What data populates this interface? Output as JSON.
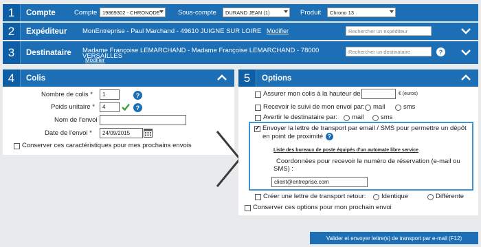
{
  "compte": {
    "number": "1",
    "title": "Compte",
    "compte_label": "Compte",
    "compte_value": "19869302 - CHRONODE",
    "sous_compte_label": "Sous-compte",
    "sous_compte_value": "DURAND JEAN (1)",
    "produit_label": "Produit",
    "produit_value": "Chrono 13",
    "chevron": "chevron-down-icon"
  },
  "expediteur": {
    "number": "2",
    "title": "Expéditeur",
    "info": "MonEntreprise - Paul Marchand - 49610 JUIGNE SUR LOIRE",
    "modifier": "Modifier",
    "search_placeholder": "Rechercher un expéditeur",
    "chevron": "chevron-down-icon"
  },
  "destinataire": {
    "number": "3",
    "title": "Destinataire",
    "info_line1": "Madame Françoise LEMARCHAND - Madame Françoise LEMARCHAND - 78000",
    "info_line2": "VERSAILLES",
    "modifier": "Modifier",
    "search_placeholder": "Rechercher un destinataire",
    "help": "?",
    "chevron": "chevron-down-icon"
  },
  "colis": {
    "number": "4",
    "title": "Colis",
    "nombre_label": "Nombre de colis *",
    "nombre_value": "1",
    "poids_label": "Poids unitaire *",
    "poids_value": "4",
    "nom_label": "Nom de l'envoi",
    "nom_value": "",
    "date_label": "Date de l'envoi *",
    "date_value": "24/09/2015",
    "conserver_label": "Conserver ces caractéristiques pour mes prochains envois",
    "help": "?",
    "chevron": "chevron-up-icon"
  },
  "options": {
    "number": "5",
    "title": "Options",
    "assurer_label": "Assurer mon colis à la hauteur de",
    "assurer_unit": "€ (euros)",
    "suivi_label": "Recevoir le suivi de mon envoi par:",
    "avertir_label": "Avertir le destinataire par:",
    "mail": "mail",
    "sms": "sms",
    "lettre_label_1": "Envoyer la lettre de transport par email / SMS pour permettre un dépôt",
    "lettre_label_2": "en point de proximité",
    "lettre_checked": true,
    "liste_link": "Liste des bureaux de poste équipés d'un automate libre service",
    "coordonnees_label_1": "Coordonnées pour recevoir le numéro de réservation (e-mail ou",
    "coordonnees_label_2": "SMS) :",
    "email_value": "client@entreprise.com",
    "retour_label": "Créer une lettre de transport retour:",
    "identique": "Identique",
    "differente": "Différente",
    "conserver_label": "Conserver ces options pour mon prochain envoi",
    "help": "?",
    "chevron": "chevron-up-icon"
  },
  "submit_label": "Valider et envoyer lettre(s) de transport par e-mail (F12)",
  "colors": {
    "primary": "#1d6fb5",
    "dark": "#0d5ea4",
    "frame": "#3c95d0"
  }
}
